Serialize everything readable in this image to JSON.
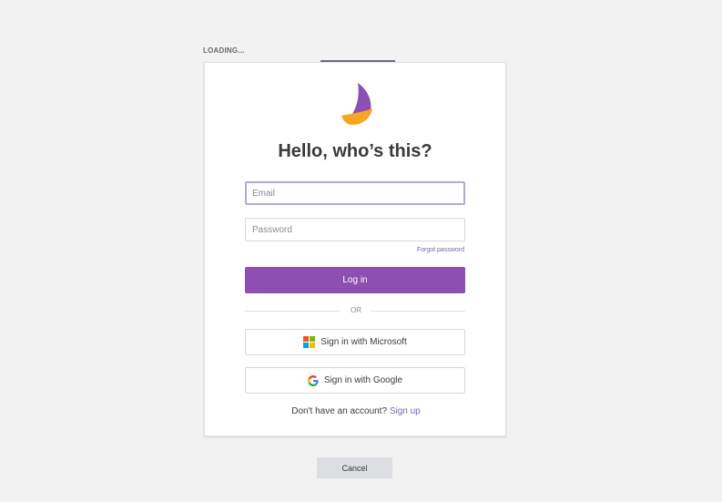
{
  "loading": {
    "label": "LOADING...",
    "progress_percent": 25
  },
  "logo": {
    "icon": "sailboat-logo-icon",
    "colors": {
      "sail": "#8e4fb3",
      "hull": "#f5a623"
    }
  },
  "login": {
    "title": "Hello, who’s this?",
    "email_placeholder": "Email",
    "email_value": "",
    "password_placeholder": "Password",
    "password_value": "",
    "forgot_label": "Forgot password",
    "login_button": "Log in",
    "or_label": "OR",
    "microsoft_button": "Sign in with Microsoft",
    "google_button": "Sign in with Google",
    "no_account_text": "Don't have an account?",
    "signup_link": "Sign up"
  },
  "footer": {
    "cancel_button": "Cancel"
  },
  "colors": {
    "accent": "#8e4fb3",
    "link": "#6b6bb0",
    "background": "#f2f2f3"
  }
}
